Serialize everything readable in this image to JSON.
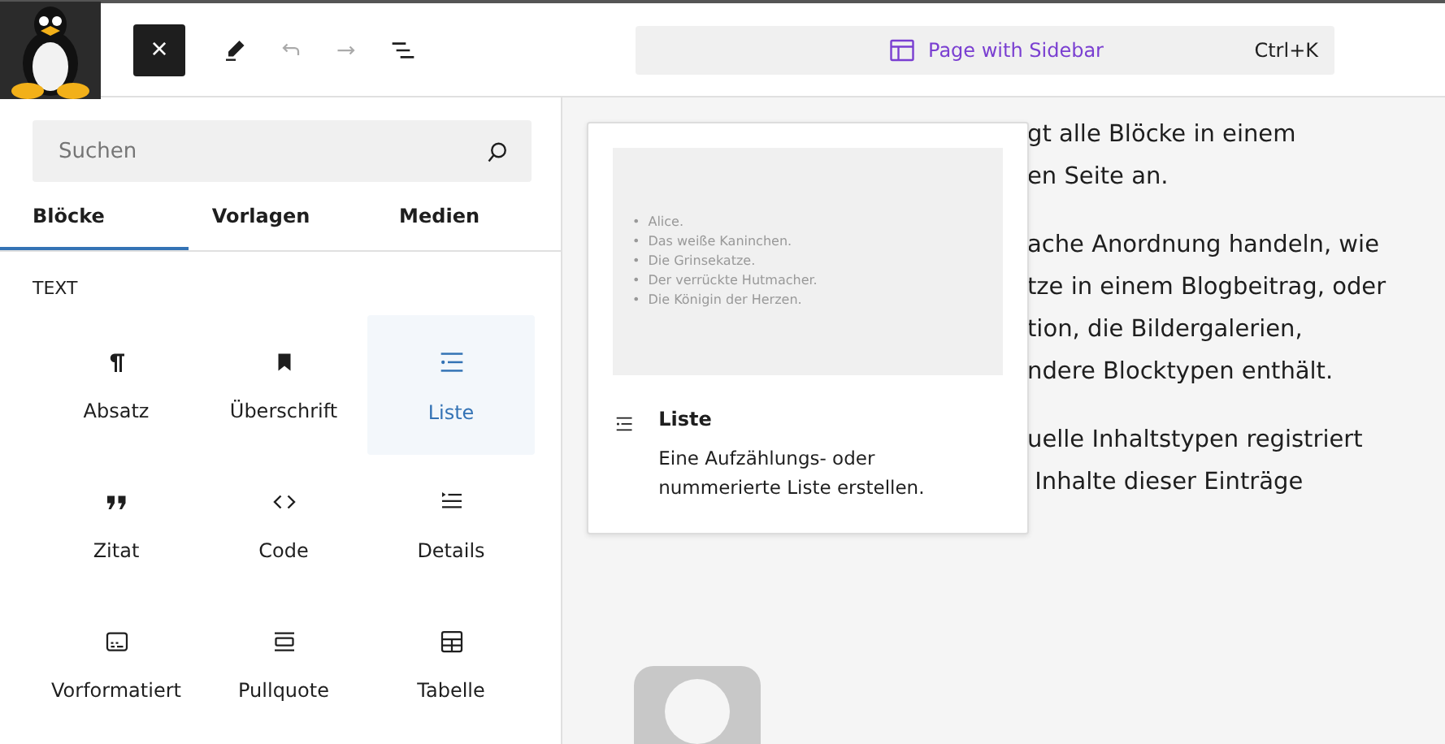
{
  "toolbar": {
    "close_label": "×",
    "template": "Page with Sidebar",
    "shortcut": "Ctrl+K"
  },
  "inserter": {
    "search": {
      "placeholder": "Suchen"
    },
    "tabs": [
      {
        "label": "Blöcke",
        "selected": true
      },
      {
        "label": "Vorlagen",
        "selected": false
      },
      {
        "label": "Medien",
        "selected": false
      }
    ],
    "category": "TEXT",
    "blocks": [
      {
        "label": "Absatz",
        "kind": "paragraph",
        "selected": false
      },
      {
        "label": "Überschrift",
        "kind": "heading",
        "selected": false
      },
      {
        "label": "Liste",
        "kind": "list",
        "selected": true
      },
      {
        "label": "Zitat",
        "kind": "quote",
        "selected": false
      },
      {
        "label": "Code",
        "kind": "code",
        "selected": false
      },
      {
        "label": "Details",
        "kind": "details",
        "selected": false
      },
      {
        "label": "Vorformatiert",
        "kind": "preformatted",
        "selected": false
      },
      {
        "label": "Pullquote",
        "kind": "pullquote",
        "selected": false
      },
      {
        "label": "Tabelle",
        "kind": "table",
        "selected": false
      }
    ]
  },
  "preview": {
    "items": [
      {
        "marker": "•",
        "text": "Alice."
      },
      {
        "marker": "•",
        "text": "Das weiße Kaninchen."
      },
      {
        "marker": "•",
        "text": "Die Grinsekatze."
      },
      {
        "marker": "•",
        "text": "Der verrückte Hutmacher."
      },
      {
        "marker": "•",
        "text": "Die Königin der Herzen."
      }
    ],
    "title": "Liste",
    "description": "Eine Aufzählungs- oder nummerierte Liste erstellen."
  },
  "content": {
    "paragraphs": [
      [
        "gt alle Blöcke in einem",
        "en Seite an."
      ],
      [
        "ache Anordnung handeln, wie",
        "tze in einem Blogbeitrag, oder",
        "tion, die Bildergalerien,",
        "ndere Blocktypen enthält."
      ],
      [
        "uelle Inhaltstypen registriert",
        " Inhalte dieser Einträge"
      ]
    ]
  }
}
